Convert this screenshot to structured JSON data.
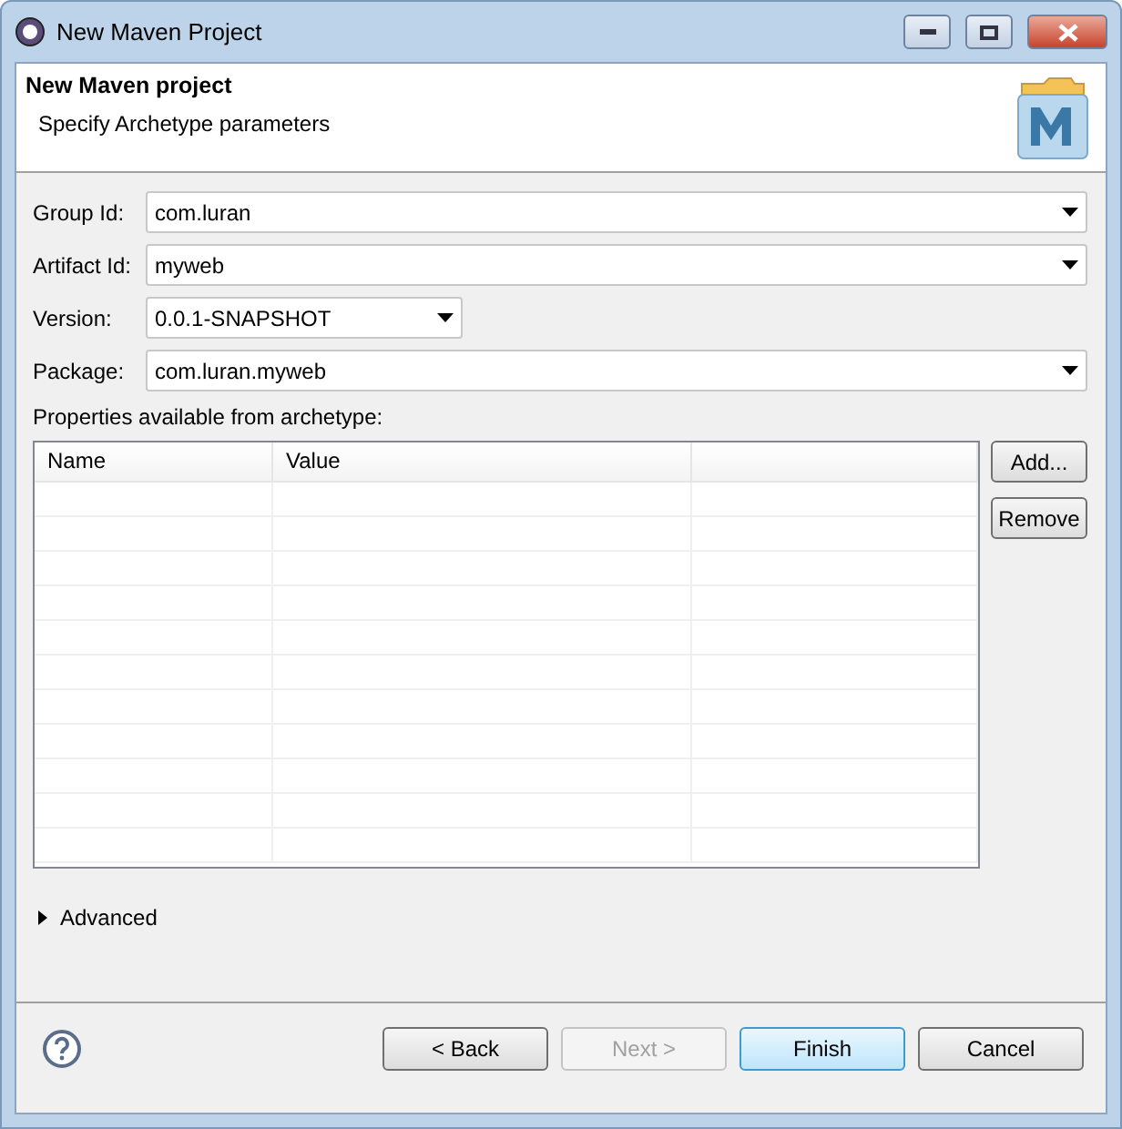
{
  "window": {
    "title": "New Maven Project"
  },
  "header": {
    "title": "New Maven project",
    "subtitle": "Specify Archetype parameters"
  },
  "fields": [
    {
      "label": "Group Id:",
      "value": "com.luran",
      "short": false
    },
    {
      "label": "Artifact Id:",
      "value": "myweb",
      "short": false
    },
    {
      "label": "Version:",
      "value": "0.0.1-SNAPSHOT",
      "short": true
    },
    {
      "label": "Package:",
      "value": "com.luran.myweb",
      "short": false
    }
  ],
  "properties": {
    "label": "Properties available from archetype:",
    "columns": [
      "Name",
      "Value"
    ],
    "buttons": [
      "Add...",
      "Remove"
    ]
  },
  "advanced": {
    "label": "Advanced",
    "expanded": false
  },
  "buttons": [
    {
      "label": "< Back",
      "disabled": false,
      "default": false
    },
    {
      "label": "Next >",
      "disabled": true,
      "default": false
    },
    {
      "label": "Finish",
      "disabled": false,
      "default": true
    },
    {
      "label": "Cancel",
      "disabled": false,
      "default": false
    }
  ]
}
